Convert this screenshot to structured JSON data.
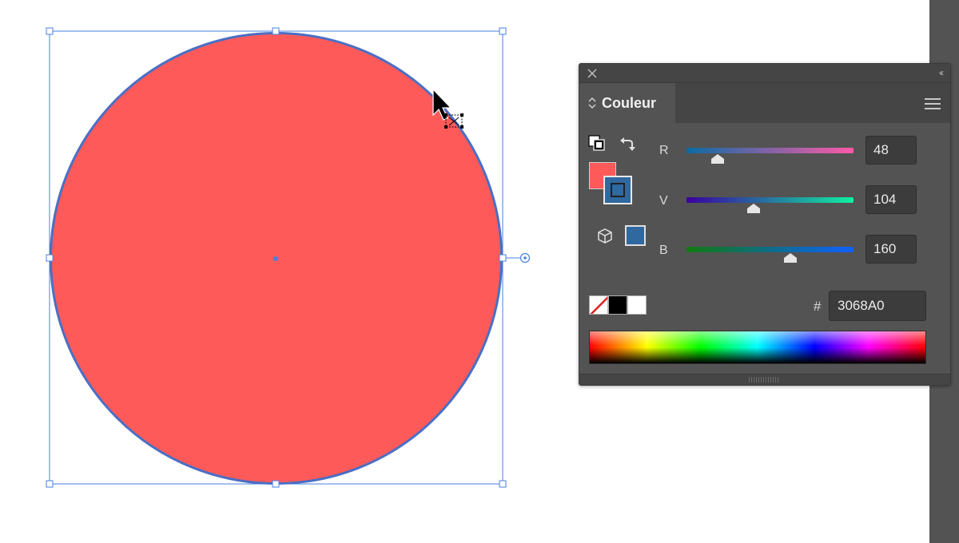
{
  "canvas": {
    "shape_fill": "#FF5A5A",
    "shape_stroke": "#4A6FC4",
    "selection_color": "#4A7FE0"
  },
  "panel": {
    "tab_label": "Couleur",
    "collapse_glyph": "‹‹",
    "sliders": [
      {
        "label": "R",
        "value": "48",
        "gradient": [
          "#0a6ba3",
          "#ff5aa8"
        ]
      },
      {
        "label": "V",
        "value": "104",
        "gradient": [
          "#3a00a0",
          "#10f0a0"
        ]
      },
      {
        "label": "B",
        "value": "160",
        "gradient": [
          "#107a10",
          "#1060ff"
        ]
      }
    ],
    "hash_label": "#",
    "hex_value": "3068A0",
    "fill_color": "#FF5A5A",
    "stroke_color": "#3068A0"
  }
}
